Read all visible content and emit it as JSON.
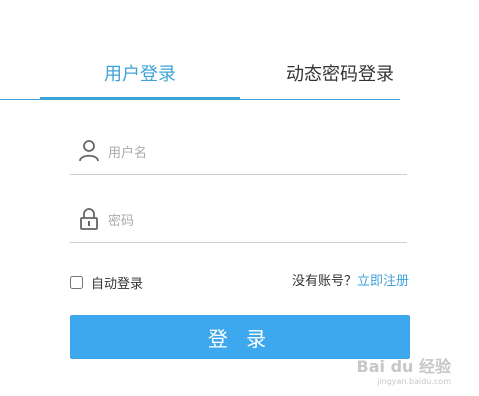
{
  "tabs": {
    "user_login": "用户登录",
    "dynamic_password_login": "动态密码登录"
  },
  "form": {
    "username_placeholder": "用户名",
    "password_placeholder": "密码",
    "remember_label": "自动登录",
    "no_account_text": "没有账号？",
    "register_link": "立即注册",
    "login_button": "登 录"
  },
  "watermark": {
    "logo_text": "Bai du 经验",
    "url": "jingyan.baidu.com"
  },
  "colors": {
    "accent": "#3ea3d8",
    "button": "#3ea8ef"
  },
  "icons": [
    "user-icon",
    "lock-icon"
  ]
}
